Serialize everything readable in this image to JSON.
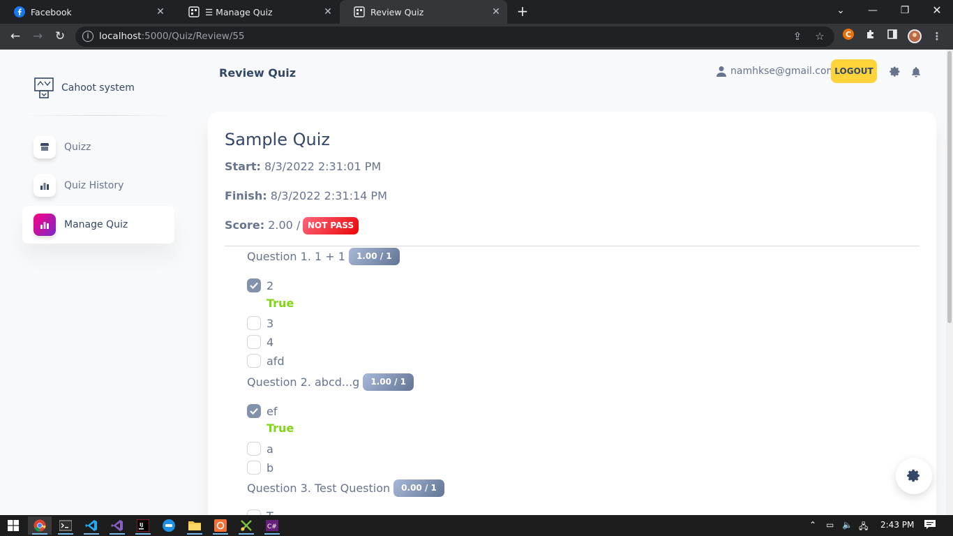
{
  "browser": {
    "tabs": [
      {
        "label": "Facebook",
        "icon": "facebook-icon"
      },
      {
        "label": "☰ Manage Quiz",
        "icon": "qr-icon"
      },
      {
        "label": "Review Quiz",
        "icon": "qr-icon"
      }
    ],
    "active_tab": 2,
    "url_host": "localhost",
    "url_rest": ":5000/Quiz/Review/55"
  },
  "sidebar": {
    "brand": "Cahoot system",
    "items": [
      {
        "label": "Quizz",
        "icon": "shop-icon"
      },
      {
        "label": "Quiz History",
        "icon": "chart-icon"
      },
      {
        "label": "Manage Quiz",
        "icon": "chart-icon"
      }
    ],
    "active_index": 2
  },
  "header": {
    "title": "Review Quiz",
    "user_email": "namhkse@gmail.com!",
    "logout_label": "LOGOUT"
  },
  "quiz": {
    "title": "Sample Quiz",
    "start_label": "Start:",
    "start_value": "8/3/2022 2:31:01 PM",
    "finish_label": "Finish:",
    "finish_value": "8/3/2022 2:31:14 PM",
    "score_label": "Score:",
    "score_value": "2.00 / 5",
    "result_badge": "NOT PASS",
    "questions": [
      {
        "text": "Question 1. 1 + 1",
        "score": "1.00 / 1",
        "options": [
          {
            "text": "2",
            "checked": true,
            "verdict": "True"
          },
          {
            "text": "3",
            "checked": false
          },
          {
            "text": "4",
            "checked": false
          },
          {
            "text": "afd",
            "checked": false
          }
        ]
      },
      {
        "text": "Question 2. abcd...g",
        "score": "1.00 / 1",
        "options": [
          {
            "text": "ef",
            "checked": true,
            "verdict": "True"
          },
          {
            "text": "a",
            "checked": false
          },
          {
            "text": "b",
            "checked": false
          }
        ]
      },
      {
        "text": "Question 3. Test Question",
        "score": "0.00 / 1",
        "options": [
          {
            "text": "T",
            "checked": false
          }
        ]
      }
    ]
  },
  "taskbar": {
    "time": "2:43 PM"
  },
  "colors": {
    "accent_gradient_start": "#7928ca",
    "accent_gradient_end": "#ff0080",
    "logout_bg": "#ffd43b",
    "fail_badge": "#ea0606",
    "true_text": "#82d616"
  }
}
